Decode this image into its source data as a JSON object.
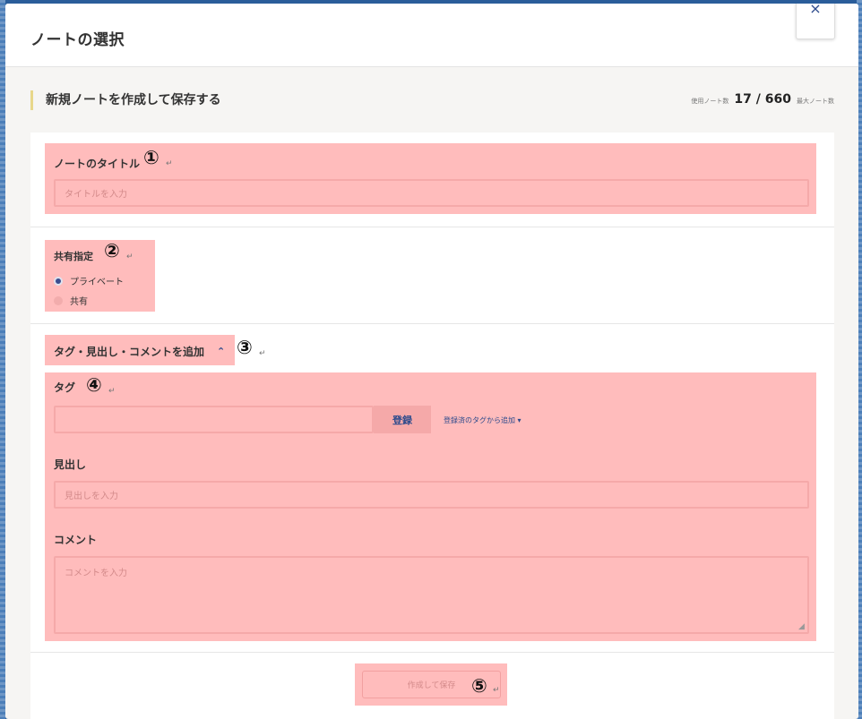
{
  "modal": {
    "title": "ノートの選択",
    "close_label": "×"
  },
  "section": {
    "heading": "新規ノートを作成して保存する",
    "note_count": {
      "used_label": "使用ノート数",
      "value": "17 / 660",
      "max_label": "最大ノート数"
    }
  },
  "form": {
    "title": {
      "label": "ノートのタイトル",
      "marker": "①",
      "placeholder": "タイトルを入力"
    },
    "share": {
      "label": "共有指定",
      "marker": "②",
      "options": [
        "プライベート",
        "共有"
      ],
      "selected": "プライベート"
    },
    "extras_toggle": {
      "label": "タグ・見出し・コメントを追加",
      "marker": "③",
      "icon": "chevron-up-icon"
    },
    "tag": {
      "label": "タグ",
      "marker": "④",
      "register_label": "登録",
      "from_registered_label": "登録済のタグから追加"
    },
    "heading_field": {
      "label": "見出し",
      "placeholder": "見出しを入力"
    },
    "comment": {
      "label": "コメント",
      "placeholder": "コメントを入力"
    },
    "submit": {
      "label": "作成して保存",
      "marker": "⑤"
    }
  },
  "return_mark": "↵",
  "colors": {
    "highlight": "#ffbcbc",
    "accent": "#2c4a8c",
    "heading_bar": "#e8d78a"
  }
}
